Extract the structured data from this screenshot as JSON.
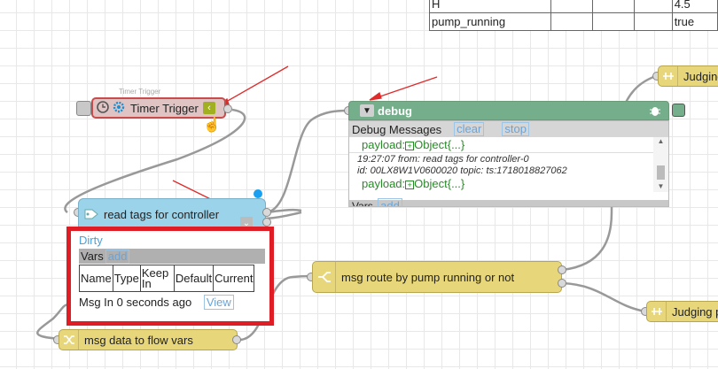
{
  "top_table": {
    "rows": [
      [
        "H",
        "",
        "",
        "",
        "4.5"
      ],
      [
        "pump_running",
        "",
        "",
        "",
        "true"
      ]
    ]
  },
  "timer": {
    "small_label": "Timer Trigger",
    "label": "Timer Trigger"
  },
  "debug": {
    "label": "debug",
    "panel_title": "Debug Messages",
    "clear_label": "clear",
    "stop_label": "stop",
    "msg1_payload": "payload:",
    "msg1_obj": "Object{...}",
    "msg2_meta1": "19:27:07 from: read tags for controller-0",
    "msg2_meta2": "id: 00LX8W1V0600020 topic: ts:1718018827062",
    "msg2_payload": "payload:",
    "msg2_obj": "Object{...}",
    "footer_vars": "Vars",
    "footer_add": "add"
  },
  "read_tags": {
    "label": "read tags for controller"
  },
  "panel": {
    "dirty": "Dirty",
    "vars_label": "Vars",
    "add_label": "add",
    "columns": [
      "Name",
      "Type",
      "Keep In",
      "Default",
      "Current"
    ],
    "status_text": "Msg In 0 seconds ago",
    "view_label": "View"
  },
  "nodes": {
    "msg_route": "msg route by pump running or not",
    "msg_data": "msg data to flow vars",
    "judging_top": "Judging",
    "judging_bottom": "Judging p"
  },
  "colors": {
    "timer_fill": "#e0c3c3",
    "debug_fill": "#75ae8a",
    "read_fill": "#9bd3ea",
    "function_fill": "#e8d77a",
    "highlight_red": "#e01c24"
  }
}
